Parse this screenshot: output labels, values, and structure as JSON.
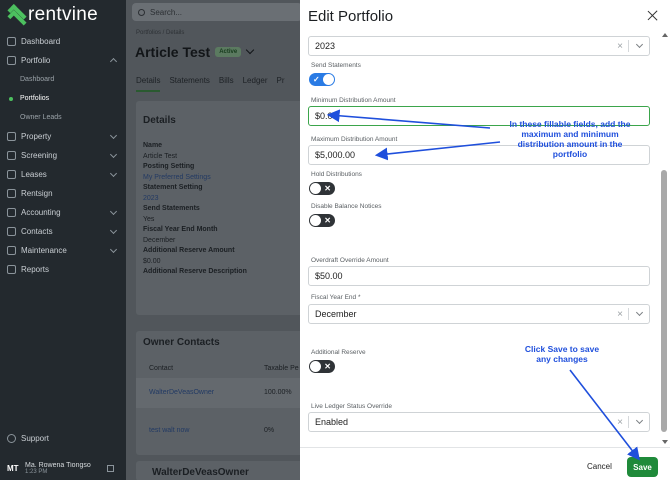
{
  "sidebar": {
    "logo_text": "rentvine",
    "items": [
      {
        "label": "Dashboard",
        "icon": "dashboard-icon"
      },
      {
        "label": "Portfolio",
        "icon": "portfolio-icon",
        "expanded": true
      },
      {
        "label": "Property",
        "icon": "property-icon"
      },
      {
        "label": "Screening",
        "icon": "screening-icon"
      },
      {
        "label": "Leases",
        "icon": "leases-icon"
      },
      {
        "label": "Rentsign",
        "icon": "rentsign-icon"
      },
      {
        "label": "Accounting",
        "icon": "accounting-icon"
      },
      {
        "label": "Contacts",
        "icon": "contacts-icon"
      },
      {
        "label": "Maintenance",
        "icon": "maintenance-icon"
      },
      {
        "label": "Reports",
        "icon": "reports-icon"
      }
    ],
    "subitems": [
      "Dashboard",
      "Portfolios",
      "Owner Leads"
    ],
    "support": "Support",
    "user": {
      "initials": "MT",
      "name": "Ma. Rowena Tiongso",
      "time": "1:23 PM"
    }
  },
  "main": {
    "search_placeholder": "Search...",
    "breadcrumb": "Portfolios  /  Details",
    "title": "Article Test",
    "status": "Active",
    "tabs": [
      "Details",
      "Statements",
      "Bills",
      "Ledger",
      "Pr"
    ],
    "details": {
      "heading": "Details",
      "rows": [
        {
          "k": "Name",
          "v": "Article Test"
        },
        {
          "k": "Posting Setting",
          "v": "My Preferred Settings",
          "link": true
        },
        {
          "k": "Statement Setting",
          "v": "2023",
          "link": true
        },
        {
          "k": "Send Statements",
          "v": "Yes"
        },
        {
          "k": "Fiscal Year End Month",
          "v": "December"
        },
        {
          "k": "Additional Reserve Amount",
          "v": "$0.00"
        },
        {
          "k": "Additional Reserve Description",
          "v": ""
        }
      ]
    },
    "owners": {
      "heading": "Owner Contacts",
      "col_contact": "Contact",
      "col_taxable": "Taxable Pe",
      "rows": [
        {
          "name": "WalterDeVeasOwner",
          "pct": "100.00%"
        },
        {
          "name": "test walt now",
          "pct": "0%"
        }
      ]
    },
    "owner_card_heading": "WalterDeVeasOwner"
  },
  "drawer": {
    "title": "Edit Portfolio",
    "statement_setting_value": "2023",
    "send_statements_label": "Send Statements",
    "send_statements_on": true,
    "min_dist_label": "Minimum Distribution Amount",
    "min_dist_value": "$0.00",
    "max_dist_label": "Maximum Distribution Amount",
    "max_dist_value": "$5,000.00",
    "hold_label": "Hold Distributions",
    "disable_balance_label": "Disable Balance Notices",
    "overdraft_label": "Overdraft Override Amount",
    "overdraft_value": "$50.00",
    "fiscal_label": "Fiscal Year End *",
    "fiscal_value": "December",
    "reserve_label": "Additional Reserve",
    "ledger_label": "Live Ledger Status Override",
    "ledger_value": "Enabled",
    "cancel": "Cancel",
    "save": "Save"
  },
  "annotations": {
    "fields_note_lines": [
      "In these fillable fields, add the",
      "maximum and minimum",
      "distribution amount in the",
      "portfolio"
    ],
    "save_note_lines": [
      "Click Save to save",
      "any changes"
    ],
    "color": "#1f4fdc"
  },
  "colors": {
    "accent": "#1f8a3a",
    "toggle_on": "#2a7be4",
    "sidebar": "#23292e"
  }
}
